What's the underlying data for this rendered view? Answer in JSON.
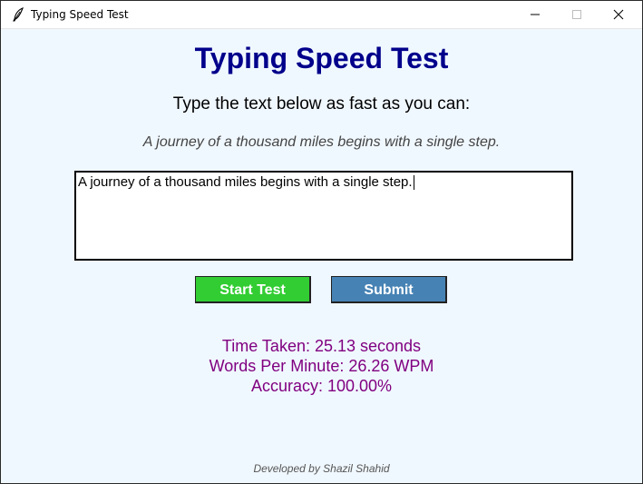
{
  "window": {
    "title": "Typing Speed Test",
    "controls": [
      "minimize-icon",
      "maximize-icon",
      "close-icon"
    ]
  },
  "app": {
    "heading": "Typing Speed Test",
    "instruction": "Type the text below as fast as you can:",
    "sample_text": "A journey of a thousand miles begins with a single step.",
    "input_value": "A journey of a thousand miles begins with a single step.",
    "buttons": {
      "start_label": "Start Test",
      "submit_label": "Submit"
    },
    "results": {
      "time_taken": "Time Taken: 25.13 seconds",
      "wpm": "Words Per Minute: 26.26 WPM",
      "accuracy": "Accuracy: 100.00%"
    },
    "footer": "Developed by Shazil Shahid"
  },
  "colors": {
    "background": "#f0f8ff",
    "heading": "#00008b",
    "start_button": "#32cd32",
    "submit_button": "#4682b4",
    "results_text": "#800080"
  }
}
